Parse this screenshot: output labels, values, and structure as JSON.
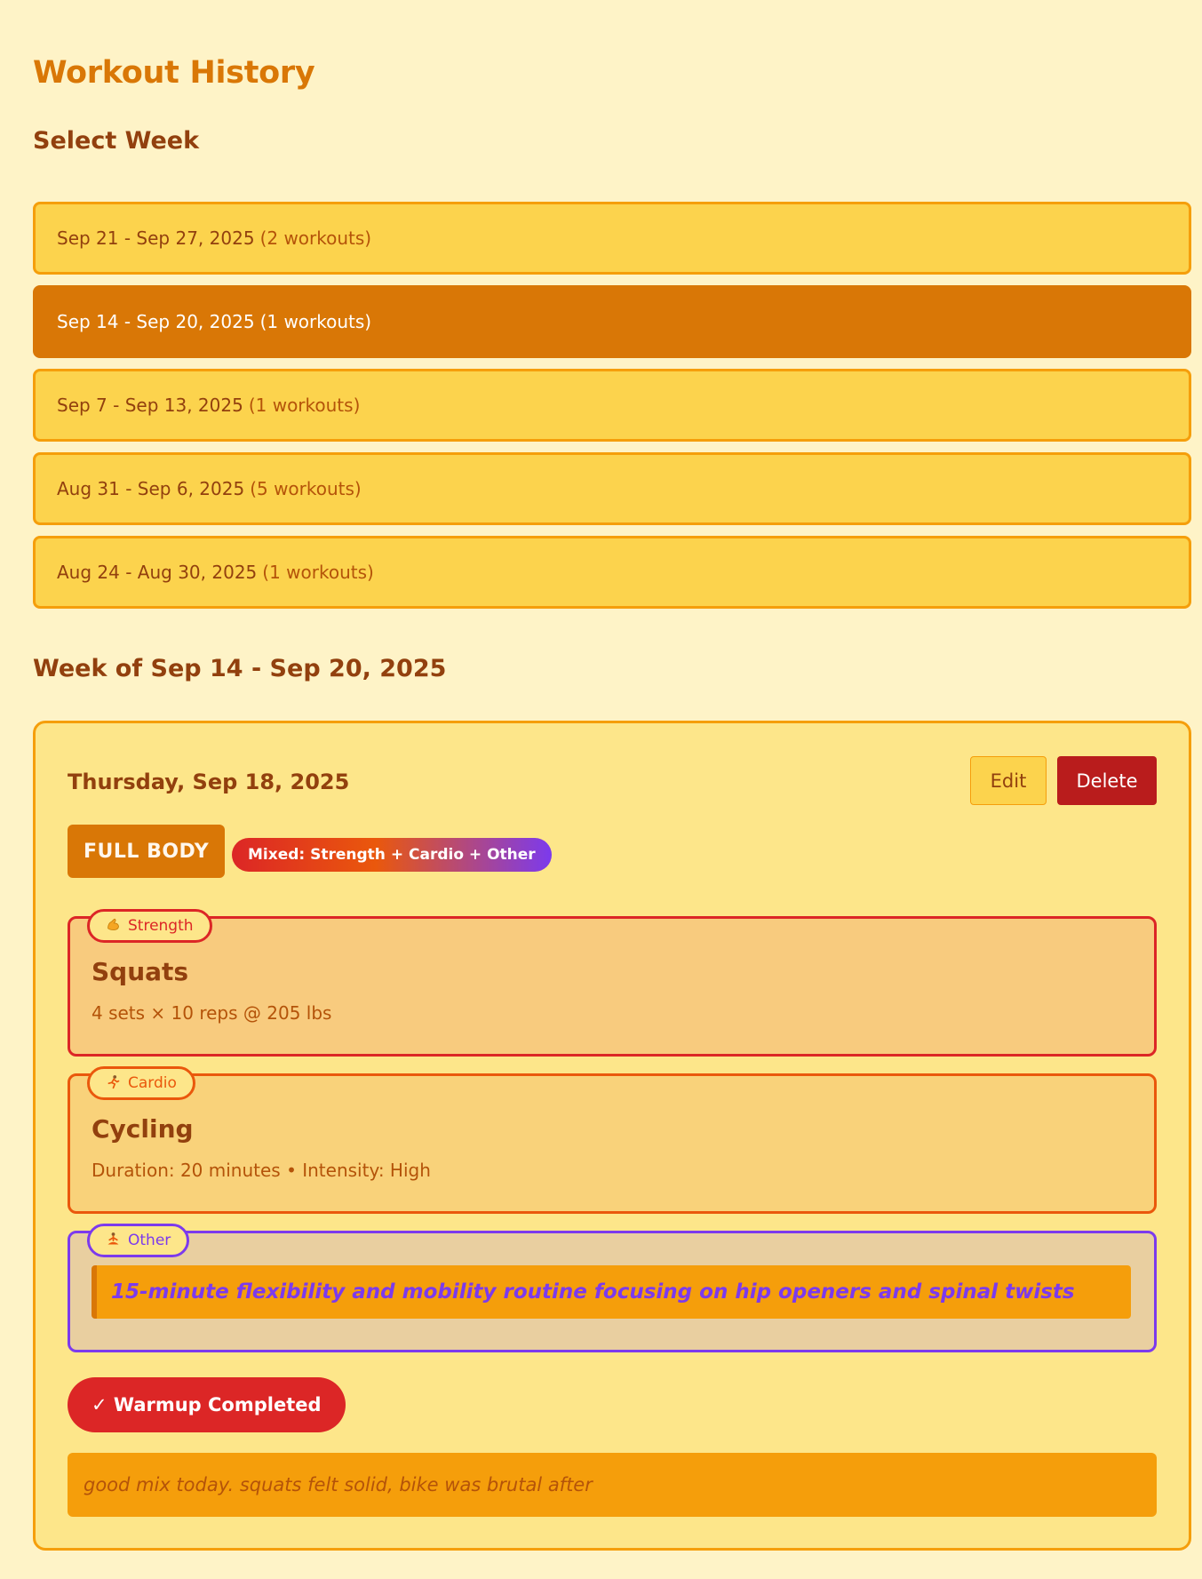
{
  "page": {
    "title": "Workout History"
  },
  "week_selector": {
    "heading": "Select Week",
    "weeks": [
      {
        "range": "Sep 21 - Sep 27, 2025",
        "count": "(2 workouts)"
      },
      {
        "range": "Sep 14 - Sep 20, 2025",
        "count": "(1 workouts)"
      },
      {
        "range": "Sep 7 - Sep 13, 2025",
        "count": "(1 workouts)"
      },
      {
        "range": "Aug 31 - Sep 6, 2025",
        "count": "(5 workouts)"
      },
      {
        "range": "Aug 24 - Aug 30, 2025",
        "count": "(1 workouts)"
      }
    ],
    "selected_week": "Sep 14 - Sep 20, 2025"
  },
  "week_detail": {
    "heading": "Week of Sep 14 - Sep 20, 2025",
    "workout": {
      "date": "Thursday, Sep 18, 2025",
      "edit_label": "Edit",
      "delete_label": "Delete",
      "type": "FULL BODY",
      "mix_label": "Mixed: Strength + Cardio + Other",
      "exercises": {
        "strength": {
          "category": "Strength",
          "icon": "flexed-bicep-icon",
          "name": "Squats",
          "detail": "4 sets × 10 reps @ 205 lbs"
        },
        "cardio": {
          "category": "Cardio",
          "icon": "runner-icon",
          "name": "Cycling",
          "detail": "Duration: 20 minutes • Intensity: High"
        },
        "other": {
          "category": "Other",
          "icon": "yoga-icon",
          "note": "15-minute flexibility and mobility routine focusing on hip openers and spinal twists"
        }
      },
      "warmup_label": "✓ Warmup Completed",
      "notes": "good mix today. squats felt solid, bike was brutal after"
    }
  },
  "colors": {
    "background": "#fef3c7",
    "accent": "#d97706",
    "week_item": "#fcd34d",
    "strength": "#dc2626",
    "cardio": "#ea580c",
    "other": "#7c3aed",
    "delete": "#b91c1c"
  }
}
